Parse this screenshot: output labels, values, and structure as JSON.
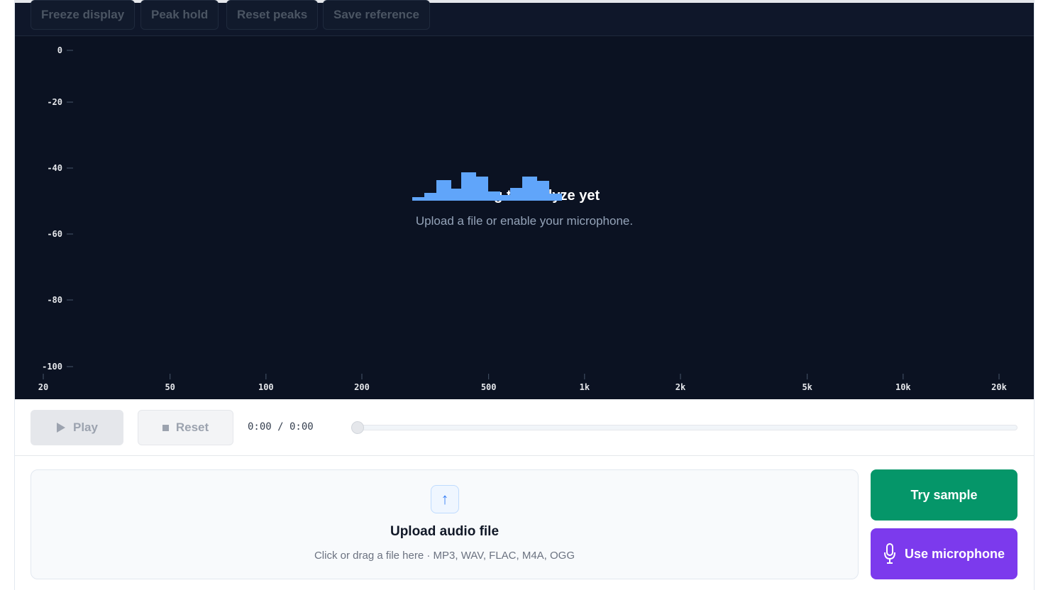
{
  "toolbar": {
    "freeze": "Freeze display",
    "peak_hold": "Peak hold",
    "reset_peaks": "Reset peaks",
    "save_reference": "Save reference"
  },
  "spectrum": {
    "y_ticks": [
      "0",
      "-20",
      "-40",
      "-60",
      "-80",
      "-100"
    ],
    "x_ticks": [
      "20",
      "50",
      "100",
      "200",
      "500",
      "1k",
      "2k",
      "5k",
      "10k",
      "20k"
    ],
    "empty_title": "Nothing to analyze yet",
    "empty_subtitle": "Upload a file or enable your microphone.",
    "accent_color": "#60a5fa",
    "background_color": "#0b1222"
  },
  "transport": {
    "play_label": "Play",
    "reset_label": "Reset",
    "time": "0:00 / 0:00",
    "progress": 0
  },
  "upload": {
    "title": "Upload audio file",
    "subtitle": "Click or drag a file here · MP3, WAV, FLAC, M4A, OGG"
  },
  "actions": {
    "sample_label": "Try sample",
    "sample_color": "#059669",
    "mic_label": "Use microphone",
    "mic_color": "#7c3aed"
  }
}
